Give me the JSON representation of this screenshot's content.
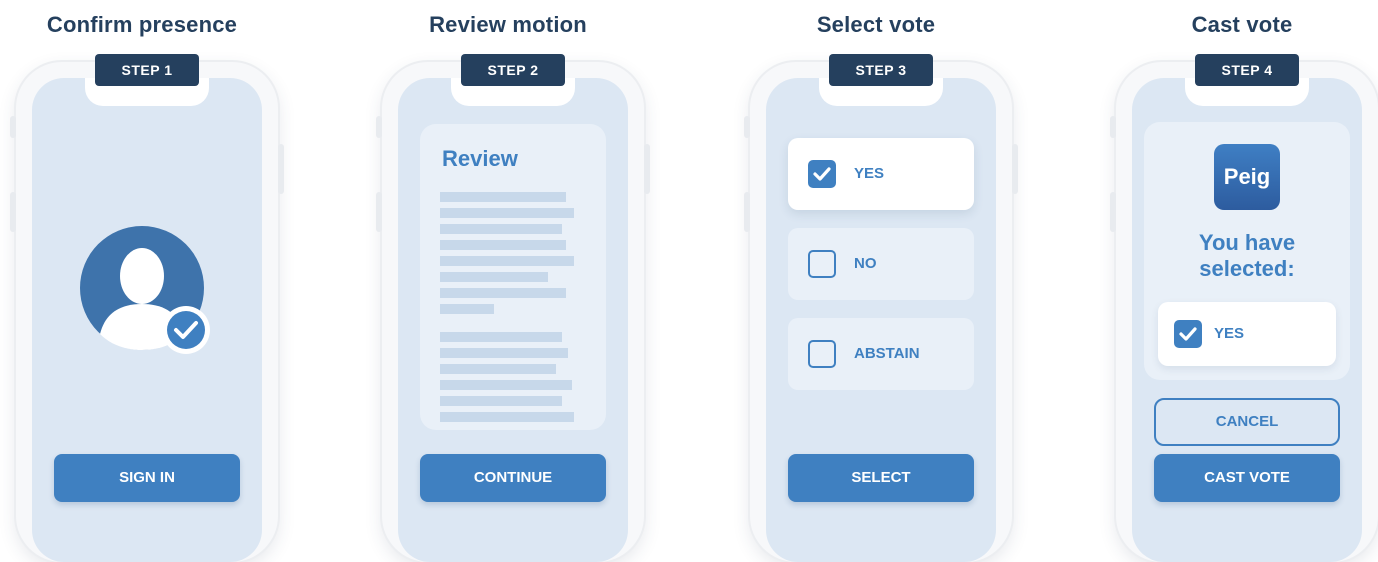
{
  "steps": [
    {
      "title": "Confirm presence",
      "badge": "STEP 1",
      "button": "SIGN IN"
    },
    {
      "title": "Review motion",
      "badge": "STEP 2",
      "button": "CONTINUE",
      "doc_title": "Review"
    },
    {
      "title": "Select vote",
      "badge": "STEP 3",
      "button": "SELECT",
      "options": [
        {
          "label": "YES",
          "checked": true
        },
        {
          "label": "NO",
          "checked": false
        },
        {
          "label": "ABSTAIN",
          "checked": false
        }
      ]
    },
    {
      "title": "Cast vote",
      "badge": "STEP 4",
      "logo": "Peig",
      "selected_heading": "You have selected:",
      "selected_option": "YES",
      "cancel": "CANCEL",
      "button": "CAST VOTE"
    }
  ],
  "colors": {
    "primary": "#3f80c1",
    "dark": "#25405e",
    "screen": "#dce7f3"
  }
}
